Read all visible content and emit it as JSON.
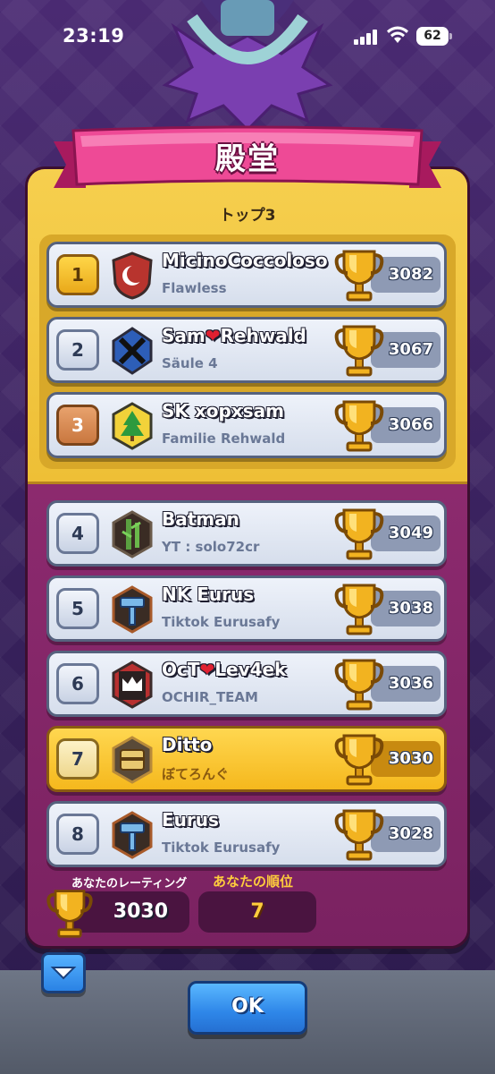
{
  "status_bar": {
    "time": "23:19",
    "battery": "62"
  },
  "title": "殿堂",
  "top3_label": "トップ3",
  "rows": [
    {
      "rank": "1",
      "name": "MicinoCoccoloso",
      "clan": "Flawless",
      "score": "3082",
      "rank_style": "gold",
      "badge_icon": "crescent-badge-icon"
    },
    {
      "rank": "2",
      "name_parts": [
        "Sam",
        "❤",
        "Rehwald"
      ],
      "clan": "Säule 4",
      "score": "3067",
      "rank_style": "silver",
      "badge_icon": "cross-badge-icon"
    },
    {
      "rank": "3",
      "name": "SK xopxsam",
      "clan": "Familie Rehwald",
      "score": "3066",
      "rank_style": "bronze",
      "badge_icon": "tree-badge-icon"
    },
    {
      "rank": "4",
      "name": "Batman",
      "clan": "YT : solo72cr",
      "score": "3049",
      "badge_icon": "bamboo-badge-icon"
    },
    {
      "rank": "5",
      "name": "NK Eurus",
      "clan": "Tiktok Eurusafy",
      "score": "3038",
      "badge_icon": "hammer-badge-icon"
    },
    {
      "rank": "6",
      "name_parts": [
        "OcT",
        "❤",
        "Lev4ek"
      ],
      "clan": "OCHIR_TEAM",
      "score": "3036",
      "badge_icon": "crown-badge-icon"
    },
    {
      "rank": "7",
      "name": "Ditto",
      "clan": "ぼてろんぐ",
      "score": "3030",
      "highlight": true,
      "badge_icon": "chest-badge-icon"
    },
    {
      "rank": "8",
      "name": "Eurus",
      "clan": "Tiktok Eurusafy",
      "score": "3028",
      "badge_icon": "hammer-badge-icon"
    }
  ],
  "footer": {
    "rating_label": "あなたのレーティング",
    "rating_value": "3030",
    "rank_label": "あなたの順位",
    "rank_value": "7"
  },
  "ok_label": "OK",
  "colors": {
    "gold_panel": "#f6cf4e",
    "purple_panel": "#8c2a6e",
    "ribbon_pink": "#e83c8c",
    "button_blue": "#2e86e8"
  }
}
